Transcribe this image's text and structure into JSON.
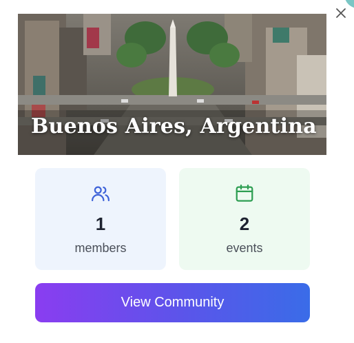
{
  "community": {
    "title": "Buenos Aires, Argentina",
    "hero_image": "city aerial photo with obelisk"
  },
  "stats": {
    "members": {
      "value": "1",
      "label": "members",
      "icon": "users-icon",
      "color": "#3f63d9"
    },
    "events": {
      "value": "2",
      "label": "events",
      "icon": "calendar-icon",
      "color": "#2e9e52"
    }
  },
  "actions": {
    "view_label": "View Community",
    "close_icon": "close-icon"
  },
  "colors": {
    "members_bg": "#eef4fd",
    "events_bg": "#eefaf1",
    "button_gradient_start": "#8a3df0",
    "button_gradient_end": "#3a6ce8"
  }
}
